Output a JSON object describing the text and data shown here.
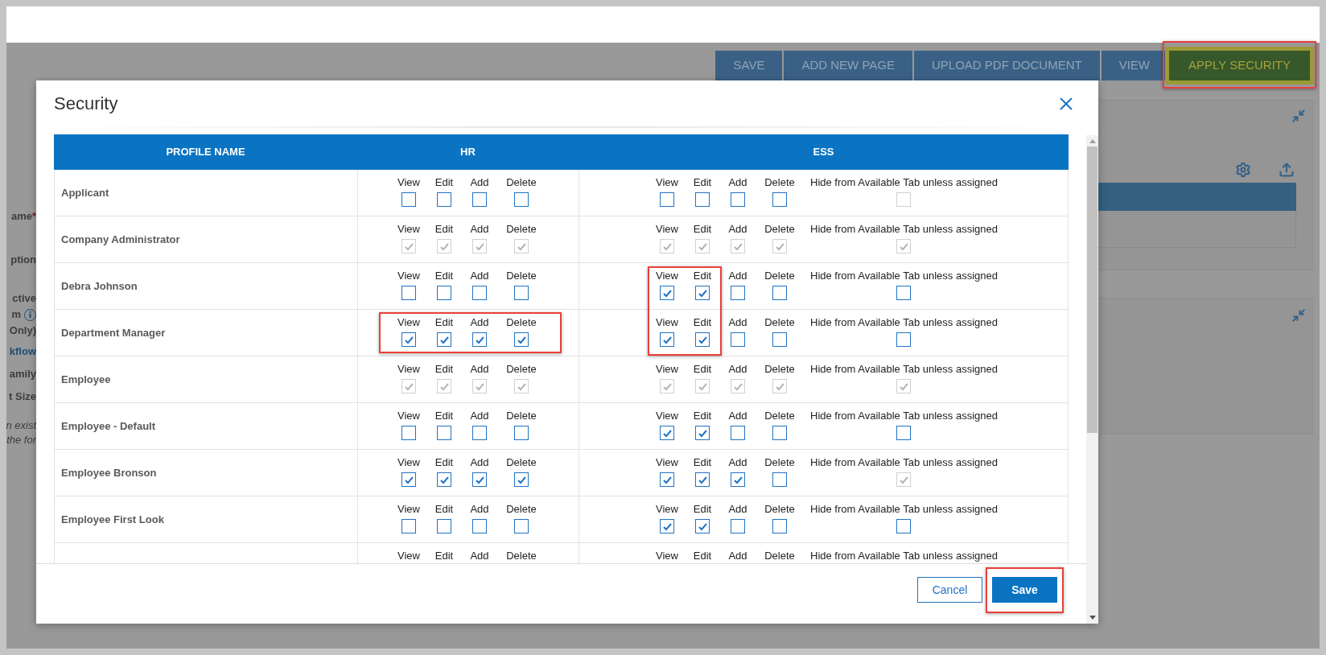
{
  "page": {
    "buttons": [
      {
        "label": "SAVE",
        "highlighted": false
      },
      {
        "label": "ADD NEW PAGE",
        "highlighted": false
      },
      {
        "label": "UPLOAD PDF DOCUMENT",
        "highlighted": false
      },
      {
        "label": "VIEW",
        "highlighted": false
      },
      {
        "label": "APPLY SECURITY",
        "highlighted": true
      }
    ],
    "form_labels": [
      {
        "text": "ame",
        "required": "*",
        "kind": "label"
      },
      {
        "text": "ption",
        "kind": "label"
      },
      {
        "text": "ctive",
        "kind": "label"
      },
      {
        "text": "m",
        "kind": "info"
      },
      {
        "text": "Only)",
        "kind": "label"
      },
      {
        "text": "kflow",
        "kind": "link"
      },
      {
        "text": "amily",
        "kind": "label"
      },
      {
        "text": "t Size",
        "kind": "label"
      },
      {
        "text": "n exist",
        "kind": "note"
      },
      {
        "text": "the for",
        "kind": "note"
      }
    ]
  },
  "modal": {
    "title": "Security",
    "columns": [
      "PROFILE NAME",
      "HR",
      "ESS"
    ],
    "rows": [
      {
        "name": "Applicant",
        "hr": {
          "highlighted": false,
          "permissions": [
            {
              "label": "View",
              "checked": false,
              "disabled": false
            },
            {
              "label": "Edit",
              "checked": false,
              "disabled": false
            },
            {
              "label": "Add",
              "checked": false,
              "disabled": false
            },
            {
              "label": "Delete",
              "checked": false,
              "disabled": false
            }
          ]
        },
        "ess": {
          "highlighted": false,
          "permissions": [
            {
              "label": "View",
              "checked": false,
              "disabled": false
            },
            {
              "label": "Edit",
              "checked": false,
              "disabled": false
            },
            {
              "label": "Add",
              "checked": false,
              "disabled": false
            },
            {
              "label": "Delete",
              "checked": false,
              "disabled": false
            }
          ],
          "hide": {
            "label": "Hide from Available Tab unless assigned",
            "checked": false,
            "disabled": true
          }
        }
      },
      {
        "name": "Company Administrator",
        "hr": {
          "highlighted": false,
          "permissions": [
            {
              "label": "View",
              "checked": true,
              "disabled": true
            },
            {
              "label": "Edit",
              "checked": true,
              "disabled": true
            },
            {
              "label": "Add",
              "checked": true,
              "disabled": true
            },
            {
              "label": "Delete",
              "checked": true,
              "disabled": true
            }
          ]
        },
        "ess": {
          "highlighted": false,
          "permissions": [
            {
              "label": "View",
              "checked": true,
              "disabled": true
            },
            {
              "label": "Edit",
              "checked": true,
              "disabled": true
            },
            {
              "label": "Add",
              "checked": true,
              "disabled": true
            },
            {
              "label": "Delete",
              "checked": true,
              "disabled": true
            }
          ],
          "hide": {
            "label": "Hide from Available Tab unless assigned",
            "checked": true,
            "disabled": true
          }
        }
      },
      {
        "name": "Debra Johnson",
        "hr": {
          "highlighted": false,
          "permissions": [
            {
              "label": "View",
              "checked": false,
              "disabled": false
            },
            {
              "label": "Edit",
              "checked": false,
              "disabled": false
            },
            {
              "label": "Add",
              "checked": false,
              "disabled": false
            },
            {
              "label": "Delete",
              "checked": false,
              "disabled": false
            }
          ]
        },
        "ess": {
          "highlighted": true,
          "permissions": [
            {
              "label": "View",
              "checked": true,
              "disabled": false
            },
            {
              "label": "Edit",
              "checked": true,
              "disabled": false
            },
            {
              "label": "Add",
              "checked": false,
              "disabled": false
            },
            {
              "label": "Delete",
              "checked": false,
              "disabled": false
            }
          ],
          "hide": {
            "label": "Hide from Available Tab unless assigned",
            "checked": false,
            "disabled": false
          }
        }
      },
      {
        "name": "Department Manager",
        "hr": {
          "highlighted": true,
          "permissions": [
            {
              "label": "View",
              "checked": true,
              "disabled": false
            },
            {
              "label": "Edit",
              "checked": true,
              "disabled": false
            },
            {
              "label": "Add",
              "checked": true,
              "disabled": false
            },
            {
              "label": "Delete",
              "checked": true,
              "disabled": false
            }
          ]
        },
        "ess": {
          "highlighted": true,
          "permissions": [
            {
              "label": "View",
              "checked": true,
              "disabled": false
            },
            {
              "label": "Edit",
              "checked": true,
              "disabled": false
            },
            {
              "label": "Add",
              "checked": false,
              "disabled": false
            },
            {
              "label": "Delete",
              "checked": false,
              "disabled": false
            }
          ],
          "hide": {
            "label": "Hide from Available Tab unless assigned",
            "checked": false,
            "disabled": false
          }
        }
      },
      {
        "name": "Employee",
        "hr": {
          "highlighted": false,
          "permissions": [
            {
              "label": "View",
              "checked": true,
              "disabled": true
            },
            {
              "label": "Edit",
              "checked": true,
              "disabled": true
            },
            {
              "label": "Add",
              "checked": true,
              "disabled": true
            },
            {
              "label": "Delete",
              "checked": true,
              "disabled": true
            }
          ]
        },
        "ess": {
          "highlighted": false,
          "permissions": [
            {
              "label": "View",
              "checked": true,
              "disabled": true
            },
            {
              "label": "Edit",
              "checked": true,
              "disabled": true
            },
            {
              "label": "Add",
              "checked": true,
              "disabled": true
            },
            {
              "label": "Delete",
              "checked": true,
              "disabled": true
            }
          ],
          "hide": {
            "label": "Hide from Available Tab unless assigned",
            "checked": true,
            "disabled": true
          }
        }
      },
      {
        "name": "Employee - Default",
        "hr": {
          "highlighted": false,
          "permissions": [
            {
              "label": "View",
              "checked": false,
              "disabled": false
            },
            {
              "label": "Edit",
              "checked": false,
              "disabled": false
            },
            {
              "label": "Add",
              "checked": false,
              "disabled": false
            },
            {
              "label": "Delete",
              "checked": false,
              "disabled": false
            }
          ]
        },
        "ess": {
          "highlighted": false,
          "permissions": [
            {
              "label": "View",
              "checked": true,
              "disabled": false
            },
            {
              "label": "Edit",
              "checked": true,
              "disabled": false
            },
            {
              "label": "Add",
              "checked": false,
              "disabled": false
            },
            {
              "label": "Delete",
              "checked": false,
              "disabled": false
            }
          ],
          "hide": {
            "label": "Hide from Available Tab unless assigned",
            "checked": false,
            "disabled": false
          }
        }
      },
      {
        "name": "Employee Bronson",
        "hr": {
          "highlighted": false,
          "permissions": [
            {
              "label": "View",
              "checked": true,
              "disabled": false
            },
            {
              "label": "Edit",
              "checked": true,
              "disabled": false
            },
            {
              "label": "Add",
              "checked": true,
              "disabled": false
            },
            {
              "label": "Delete",
              "checked": true,
              "disabled": false
            }
          ]
        },
        "ess": {
          "highlighted": false,
          "permissions": [
            {
              "label": "View",
              "checked": true,
              "disabled": false
            },
            {
              "label": "Edit",
              "checked": true,
              "disabled": false
            },
            {
              "label": "Add",
              "checked": true,
              "disabled": false
            },
            {
              "label": "Delete",
              "checked": false,
              "disabled": false
            }
          ],
          "hide": {
            "label": "Hide from Available Tab unless assigned",
            "checked": true,
            "disabled": true
          }
        }
      },
      {
        "name": "Employee First Look",
        "hr": {
          "highlighted": false,
          "permissions": [
            {
              "label": "View",
              "checked": false,
              "disabled": false
            },
            {
              "label": "Edit",
              "checked": false,
              "disabled": false
            },
            {
              "label": "Add",
              "checked": false,
              "disabled": false
            },
            {
              "label": "Delete",
              "checked": false,
              "disabled": false
            }
          ]
        },
        "ess": {
          "highlighted": false,
          "permissions": [
            {
              "label": "View",
              "checked": true,
              "disabled": false
            },
            {
              "label": "Edit",
              "checked": true,
              "disabled": false
            },
            {
              "label": "Add",
              "checked": false,
              "disabled": false
            },
            {
              "label": "Delete",
              "checked": false,
              "disabled": false
            }
          ],
          "hide": {
            "label": "Hide from Available Tab unless assigned",
            "checked": false,
            "disabled": false
          }
        }
      },
      {
        "hr": {
          "highlighted": false,
          "permissions": [
            {
              "label": "View"
            },
            {
              "label": "Edit"
            },
            {
              "label": "Add"
            },
            {
              "label": "Delete"
            }
          ]
        },
        "ess": {
          "highlighted": false,
          "permissions": [
            {
              "label": "View"
            },
            {
              "label": "Edit"
            },
            {
              "label": "Add"
            },
            {
              "label": "Delete"
            }
          ],
          "hide": {
            "label": "Hide from Available Tab unless assigned"
          }
        }
      }
    ],
    "buttons": [
      {
        "label": "Cancel",
        "kind": "secondary",
        "highlighted": false
      },
      {
        "label": "Save",
        "kind": "primary",
        "highlighted": true
      }
    ]
  }
}
